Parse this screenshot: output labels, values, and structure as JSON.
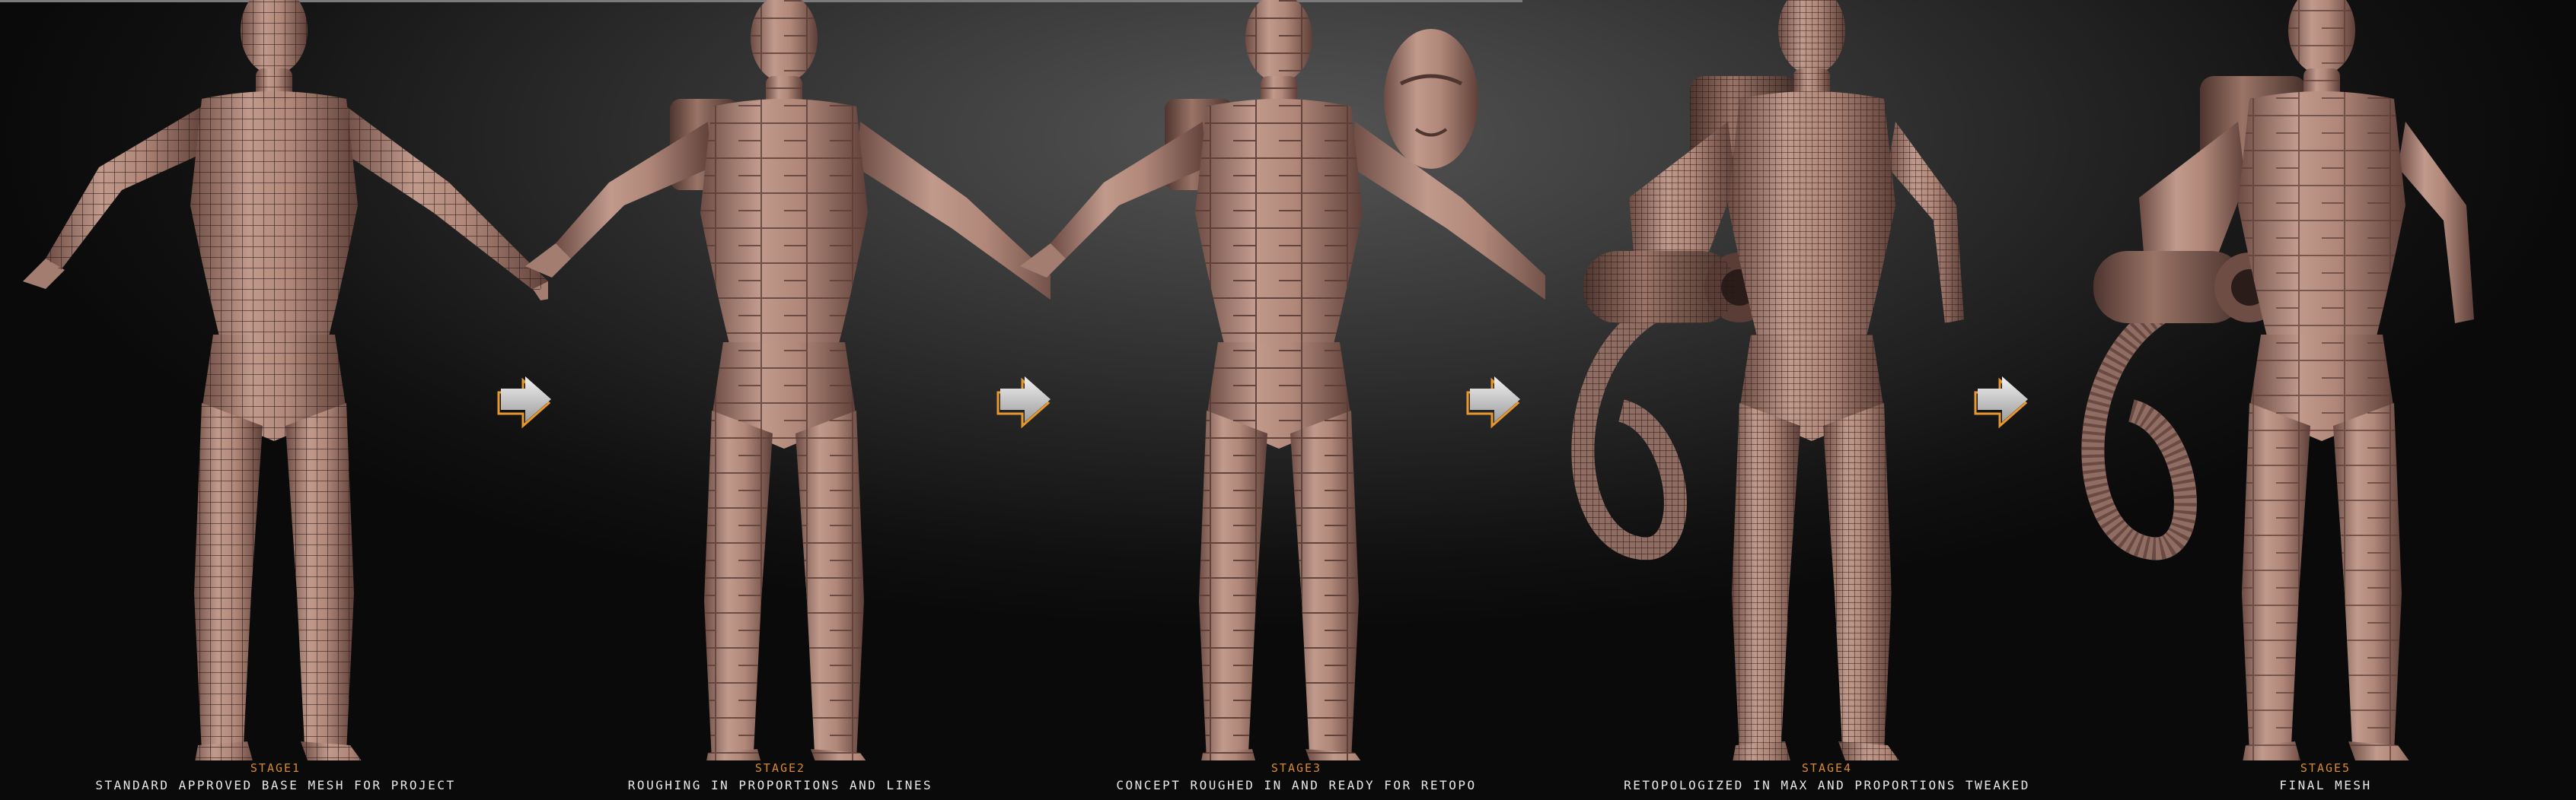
{
  "stages": [
    {
      "label": "STAGE1",
      "desc": "STANDARD APPROVED BASE MESH FOR PROJECT"
    },
    {
      "label": "STAGE2",
      "desc": "ROUGHING IN PROPORTIONS AND LINES"
    },
    {
      "label": "STAGE3",
      "desc": "CONCEPT ROUGHED IN AND READY FOR RETOPO"
    },
    {
      "label": "STAGE4",
      "desc": "RETOPOLOGIZED IN MAX AND PROPORTIONS TWEAKED"
    },
    {
      "label": "STAGE5",
      "desc": "FINAL MESH"
    }
  ],
  "colors": {
    "clay": "#b48a7c",
    "clay_shadow": "#6e4d45",
    "stage_label": "#d9892c",
    "caption_text": "#e8e8e8",
    "arrow_fill": "#d8d8d8",
    "arrow_outline": "#e8962e"
  }
}
